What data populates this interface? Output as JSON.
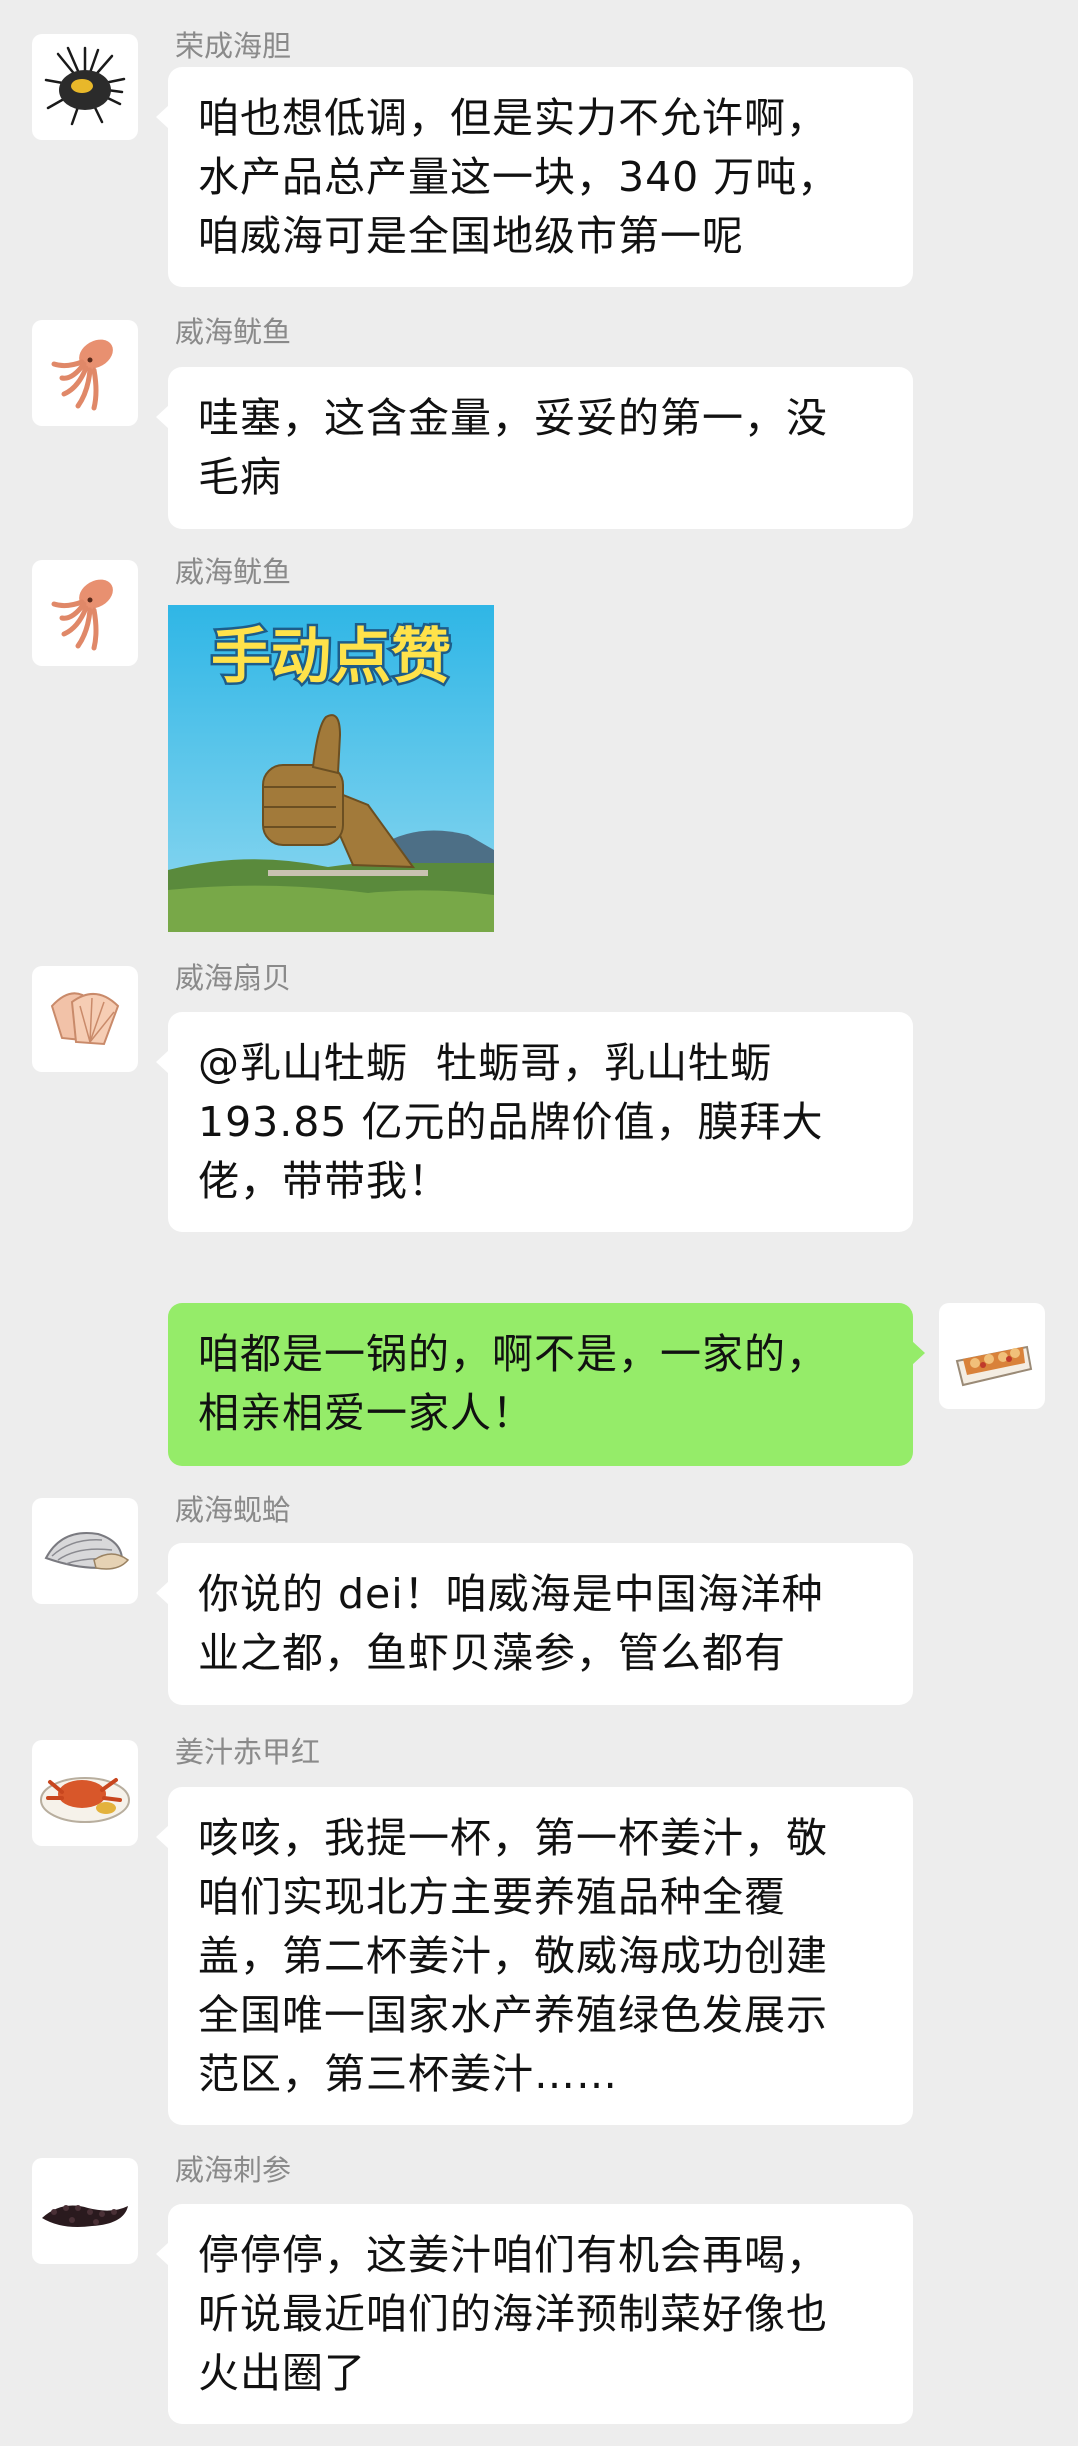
{
  "messages": [
    {
      "sender": "荣成海胆",
      "avatar_icon": "sea-urchin-icon",
      "lines": [
        "咱也想低调，但是实力不允许啊，",
        "水产品总产量这一块，340 万吨，",
        "咱威海可是全国地级市第一呢"
      ]
    },
    {
      "sender": "威海鱿鱼",
      "avatar_icon": "squid-icon",
      "lines": [
        "哇塞，这含金量，妥妥的第一，没",
        "毛病"
      ]
    },
    {
      "sender": "威海鱿鱼",
      "avatar_icon": "squid-icon",
      "sticker_text": "手动点赞",
      "sticker_icon": "thumbs-up-statue-icon"
    },
    {
      "sender": "威海扇贝",
      "avatar_icon": "scallop-icon",
      "mention": "@乳山牡蛎",
      "lines": [
        "  牡蛎哥，乳山牡蛎",
        "193.85 亿元的品牌价值，膜拜大",
        "佬，带带我！"
      ]
    },
    {
      "self": true,
      "avatar_icon": "prepared-seafood-dish-icon",
      "lines": [
        "咱都是一锅的，啊不是，一家的，",
        "相亲相爱一家人！"
      ]
    },
    {
      "sender": "威海蚬蛤",
      "avatar_icon": "clam-icon",
      "lines": [
        "你说的 dei！咱威海是中国海洋种",
        "业之都，鱼虾贝藻参，管么都有"
      ]
    },
    {
      "sender": "姜汁赤甲红",
      "avatar_icon": "crab-dish-icon",
      "lines": [
        "咳咳，我提一杯，第一杯姜汁，敬",
        "咱们实现北方主要养殖品种全覆",
        "盖，第二杯姜汁，敬威海成功创建",
        "全国唯一国家水产养殖绿色发展示",
        "范区，第三杯姜汁……"
      ]
    },
    {
      "sender": "威海刺参",
      "avatar_icon": "sea-cucumber-icon",
      "lines": [
        "停停停，这姜汁咱们有机会再喝，",
        "听说最近咱们的海洋预制菜好像也",
        "火出圈了"
      ]
    }
  ],
  "colors": {
    "background": "#ededed",
    "bubble_in": "#ffffff",
    "bubble_out": "#95ec69",
    "sender_name": "#8a8a8a"
  }
}
